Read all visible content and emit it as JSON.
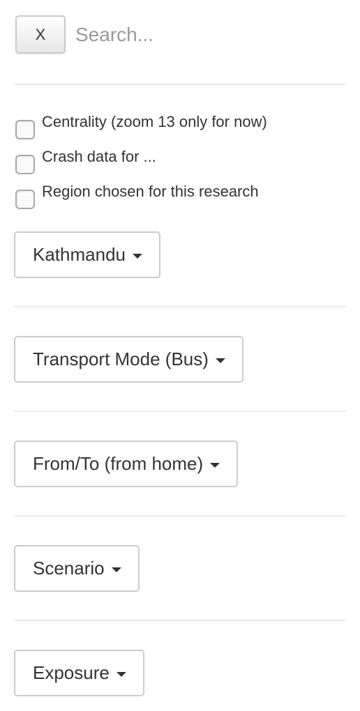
{
  "search": {
    "close_label": "X",
    "placeholder": "Search...",
    "value": ""
  },
  "layers": [
    {
      "label": "Centrality (zoom 13 only for now)",
      "checked": false
    },
    {
      "label": "Crash data for ...",
      "checked": false
    },
    {
      "label": "Region chosen for this research",
      "checked": false
    }
  ],
  "dropdowns": {
    "region": "Kathmandu",
    "transport_mode": "Transport Mode (Bus)",
    "from_to": "From/To (from home)",
    "scenario": "Scenario",
    "exposure": "Exposure"
  }
}
